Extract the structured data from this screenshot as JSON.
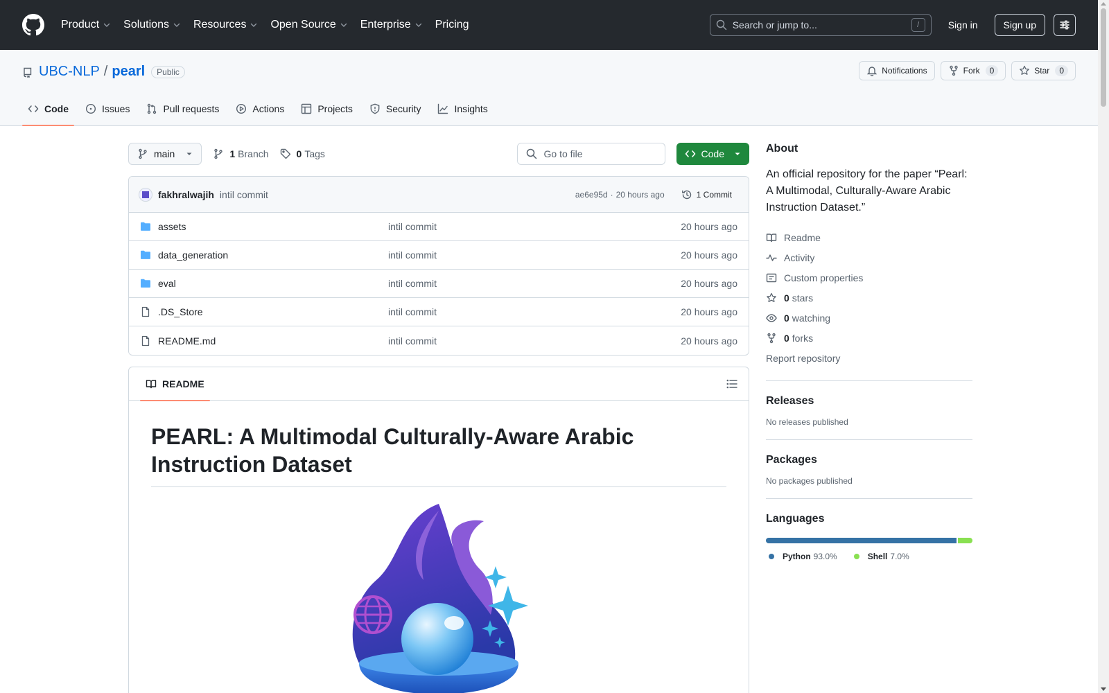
{
  "header": {
    "nav": [
      {
        "label": "Product",
        "has_caret": true
      },
      {
        "label": "Solutions",
        "has_caret": true
      },
      {
        "label": "Resources",
        "has_caret": true
      },
      {
        "label": "Open Source",
        "has_caret": true
      },
      {
        "label": "Enterprise",
        "has_caret": true
      },
      {
        "label": "Pricing",
        "has_caret": false
      }
    ],
    "search_placeholder": "Search or jump to...",
    "search_shortcut": "/",
    "sign_in": "Sign in",
    "sign_up": "Sign up"
  },
  "repo": {
    "owner": "UBC-NLP",
    "separator": "/",
    "name": "pearl",
    "visibility": "Public",
    "notifications_label": "Notifications",
    "fork_label": "Fork",
    "fork_count": "0",
    "star_label": "Star",
    "star_count": "0",
    "tabs": [
      {
        "label": "Code",
        "icon": "code-icon",
        "active": true
      },
      {
        "label": "Issues",
        "icon": "issue-icon",
        "active": false
      },
      {
        "label": "Pull requests",
        "icon": "pull-request-icon",
        "active": false
      },
      {
        "label": "Actions",
        "icon": "play-icon",
        "active": false
      },
      {
        "label": "Projects",
        "icon": "table-icon",
        "active": false
      },
      {
        "label": "Security",
        "icon": "shield-icon",
        "active": false
      },
      {
        "label": "Insights",
        "icon": "graph-icon",
        "active": false
      }
    ]
  },
  "toolbar": {
    "branch": "main",
    "branch_count": "1",
    "branch_label": "Branch",
    "tag_count": "0",
    "tag_label": "Tags",
    "goto_placeholder": "Go to file",
    "code_label": "Code"
  },
  "commit": {
    "author": "fakhralwajih",
    "message": "intil commit",
    "hash": "ae6e95d",
    "dot": "·",
    "time": "20 hours ago",
    "commits_label": "1 Commit"
  },
  "files": [
    {
      "name": "assets",
      "type": "folder",
      "message": "intil commit",
      "time": "20 hours ago"
    },
    {
      "name": "data_generation",
      "type": "folder",
      "message": "intil commit",
      "time": "20 hours ago"
    },
    {
      "name": "eval",
      "type": "folder",
      "message": "intil commit",
      "time": "20 hours ago"
    },
    {
      "name": ".DS_Store",
      "type": "file",
      "message": "intil commit",
      "time": "20 hours ago"
    },
    {
      "name": "README.md",
      "type": "file",
      "message": "intil commit",
      "time": "20 hours ago"
    }
  ],
  "readme": {
    "tab_label": "README",
    "title": "PEARL: A Multimodal Culturally-Aware Arabic Instruction Dataset"
  },
  "sidebar": {
    "about_heading": "About",
    "about_text": "An official repository for the paper “Pearl: A Multimodal, Culturally-Aware Arabic Instruction Dataset.”",
    "links": [
      {
        "icon": "book-icon",
        "count": "",
        "label": "Readme"
      },
      {
        "icon": "pulse-icon",
        "count": "",
        "label": "Activity"
      },
      {
        "icon": "note-icon",
        "count": "",
        "label": "Custom properties"
      },
      {
        "icon": "star-icon",
        "count": "0",
        "label": "stars"
      },
      {
        "icon": "eye-icon",
        "count": "0",
        "label": "watching"
      },
      {
        "icon": "fork-icon",
        "count": "0",
        "label": "forks"
      }
    ],
    "report": "Report repository",
    "releases_heading": "Releases",
    "releases_text": "No releases published",
    "packages_heading": "Packages",
    "packages_text": "No packages published",
    "languages_heading": "Languages",
    "languages": [
      {
        "name": "Python",
        "percent": "93.0%",
        "value": 93.0,
        "color": "#3572A5"
      },
      {
        "name": "Shell",
        "percent": "7.0%",
        "value": 7.0,
        "color": "#89e051"
      }
    ]
  },
  "colors": {
    "header_bg": "#25292e",
    "link": "#0969da",
    "green_button": "#1f883d",
    "active_tab_underline": "#fd8c73",
    "folder": "#54aeff"
  }
}
